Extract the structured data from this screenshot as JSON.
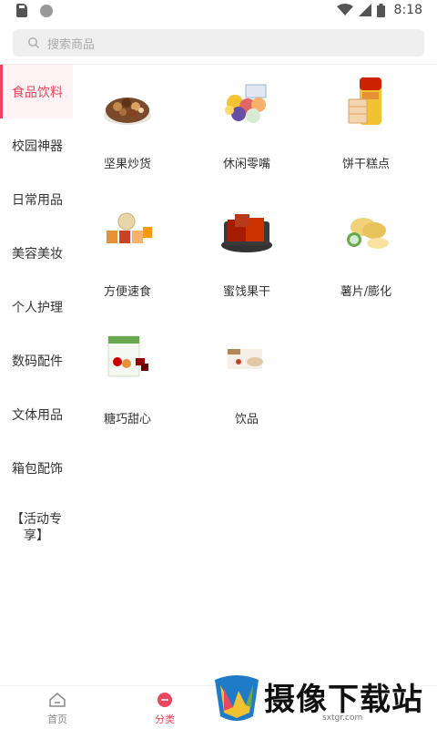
{
  "status_bar": {
    "time": "8:18"
  },
  "search": {
    "placeholder": "搜索商品"
  },
  "sidebar": {
    "items": [
      {
        "label": "食品饮料",
        "active": true
      },
      {
        "label": "校园神器"
      },
      {
        "label": "日常用品"
      },
      {
        "label": "美容美妆"
      },
      {
        "label": "个人护理"
      },
      {
        "label": "数码配件"
      },
      {
        "label": "文体用品"
      },
      {
        "label": "箱包配饰"
      },
      {
        "label": "【活动专享】"
      }
    ]
  },
  "categories": [
    {
      "label": "坚果炒货"
    },
    {
      "label": "休闲零嘴"
    },
    {
      "label": "饼干糕点"
    },
    {
      "label": "方便速食"
    },
    {
      "label": "蜜饯果干"
    },
    {
      "label": "薯片/膨化"
    },
    {
      "label": "糖巧甜心"
    },
    {
      "label": "饮品"
    }
  ],
  "bottom_nav": {
    "items": [
      {
        "label": "首页",
        "icon": "home-icon"
      },
      {
        "label": "分类",
        "icon": "category-icon",
        "active": true
      }
    ]
  },
  "watermark": {
    "title": "摄像下载站",
    "url": "sxtgr.com"
  },
  "colors": {
    "accent": "#e8475d",
    "search_bg": "#efefef"
  }
}
